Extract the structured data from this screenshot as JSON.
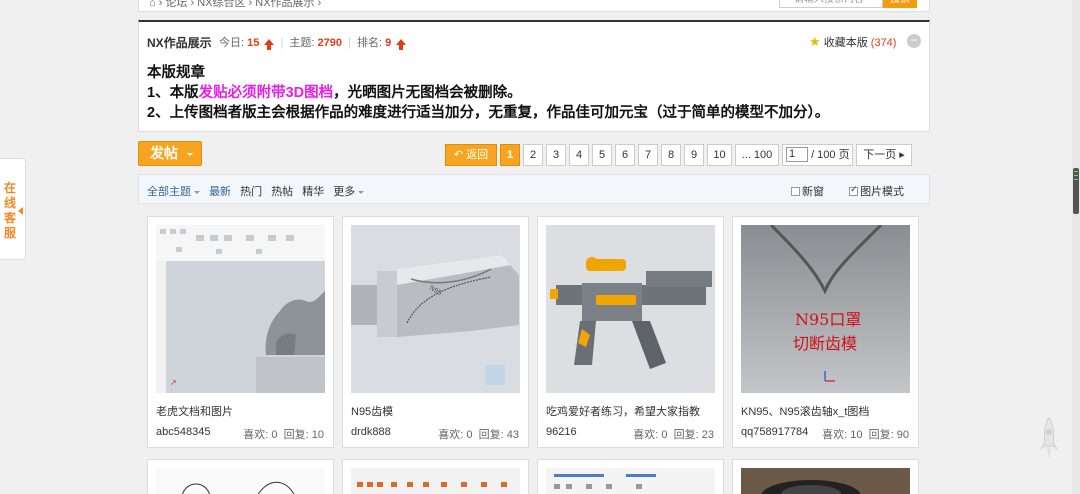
{
  "chat_tab": {
    "label": "在线客服"
  },
  "topbar": {
    "breadcrumb": "⌂ › 论坛 › NX综合区 › NX作品展示 ›",
    "search_placeholder": "请输入搜索内容",
    "search_button": "搜索"
  },
  "forum": {
    "title": "NX作品展示",
    "today_label": "今日:",
    "today_value": "15",
    "topics_label": "主题:",
    "topics_value": "2790",
    "rank_label": "排名:",
    "rank_value": "9",
    "fav_label": "收藏本版",
    "fav_count": "(374)",
    "collapse": "−",
    "rules_title": "本版规章",
    "rule1_prefix": "1、本版",
    "rule1_highlight": "发贴必须附带3D图档",
    "rule1_suffix": "，光晒图片无图档会被删除。",
    "rule2": "2、上传图档者版主会根据作品的难度进行适当加分，无重复，作品佳可加元宝（过于简单的模型不加分）。"
  },
  "toolbar": {
    "post_button": "发帖"
  },
  "pager": {
    "back": "返回",
    "pages": [
      "1",
      "2",
      "3",
      "4",
      "5",
      "6",
      "7",
      "8",
      "9",
      "10"
    ],
    "current": "1",
    "last": "... 100",
    "jump_value": "1",
    "jump_total": "/ 100 页",
    "next": "下一页"
  },
  "filter": {
    "all": "全部主题",
    "latest": "最新",
    "hot": "热门",
    "hot_post": "热帖",
    "digest": "精华",
    "more": "更多",
    "new_window": "新窗",
    "image_mode": "图片模式",
    "image_mode_checked": true
  },
  "cards": [
    {
      "title": "老虎文档和图片",
      "author": "abc548345",
      "likes": "喜欢: 0",
      "replies": "回复: 10"
    },
    {
      "title": "N95齿模",
      "author": "drdk888",
      "likes": "喜欢: 0",
      "replies": "回复: 43"
    },
    {
      "title": "吃鸡爱好者练习，希望大家指教",
      "author": "96216",
      "likes": "喜欢: 0",
      "replies": "回复: 23"
    },
    {
      "title": "KN95、N95滚齿轴x_t图档",
      "author": "qq758917784",
      "likes": "喜欢: 10",
      "replies": "回复: 90"
    }
  ],
  "thumb_text": {
    "mask_line1": "N95口罩",
    "mask_line2": "切断齿模"
  },
  "colors": {
    "accent": "#f7a520",
    "highlight": "#e61ee6",
    "stat": "#e23b18"
  }
}
